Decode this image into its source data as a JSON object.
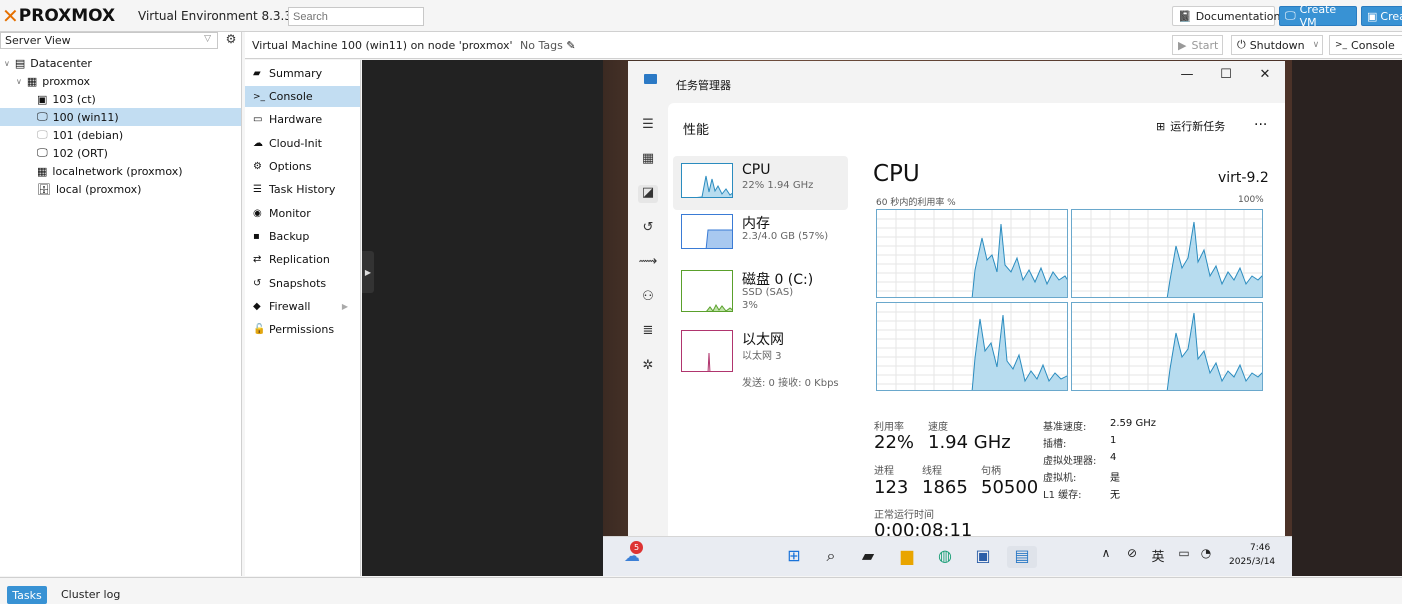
{
  "top": {
    "logo_text": "PROXMOX",
    "version": "Virtual Environment 8.3.3",
    "search_placeholder": "Search",
    "documentation": "Documentation",
    "create_vm": "Create VM",
    "create_ct": "Crea"
  },
  "tree": {
    "view": "Server View",
    "items": [
      {
        "label": "Datacenter",
        "icon": "datacenter-icon"
      },
      {
        "label": "proxmox",
        "icon": "node-icon"
      },
      {
        "label": "103 (ct)",
        "icon": "container-icon"
      },
      {
        "label": "100 (win11)",
        "icon": "vm-running-icon"
      },
      {
        "label": "101 (debian)",
        "icon": "vm-stopped-icon"
      },
      {
        "label": "102 (ORT)",
        "icon": "vm-running-icon"
      },
      {
        "label": "localnetwork (proxmox)",
        "icon": "network-icon"
      },
      {
        "label": "local (proxmox)",
        "icon": "storage-icon"
      }
    ]
  },
  "vm": {
    "title": "Virtual Machine 100 (win11) on node 'proxmox'",
    "tags": "No Tags",
    "start": "Start",
    "shutdown": "Shutdown",
    "console": "Console"
  },
  "nav": [
    {
      "label": "Summary",
      "icon": "book-icon"
    },
    {
      "label": "Console",
      "icon": "terminal-icon"
    },
    {
      "label": "Hardware",
      "icon": "desktop-icon"
    },
    {
      "label": "Cloud-Init",
      "icon": "cloud-icon"
    },
    {
      "label": "Options",
      "icon": "gear-icon"
    },
    {
      "label": "Task History",
      "icon": "list-icon"
    },
    {
      "label": "Monitor",
      "icon": "eye-icon"
    },
    {
      "label": "Backup",
      "icon": "floppy-icon"
    },
    {
      "label": "Replication",
      "icon": "retweet-icon"
    },
    {
      "label": "Snapshots",
      "icon": "history-icon"
    },
    {
      "label": "Firewall",
      "icon": "shield-icon"
    },
    {
      "label": "Permissions",
      "icon": "unlock-icon"
    }
  ],
  "taskmanager": {
    "title": "任务管理器",
    "section": "性能",
    "run_new_task": "运行新任务",
    "cards": [
      {
        "name": "CPU",
        "sub1": "22% 1.94 GHz",
        "sub2": ""
      },
      {
        "name": "内存",
        "sub1": "2.3/4.0 GB (57%)",
        "sub2": ""
      },
      {
        "name": "磁盘 0 (C:)",
        "sub1": "SSD (SAS)",
        "sub2": "3%"
      },
      {
        "name": "以太网",
        "sub1": "以太网 3",
        "sub2": "发送: 0 接收: 0 Kbps"
      }
    ],
    "cpu_heading": "CPU",
    "cpu_model": "virt-9.2",
    "util_caption": "60 秒内的利用率 %",
    "util_max": "100%",
    "stats": {
      "utilization_label": "利用率",
      "utilization": "22%",
      "speed_label": "速度",
      "speed": "1.94 GHz",
      "processes_label": "进程",
      "processes": "123",
      "threads_label": "线程",
      "threads": "1865",
      "handles_label": "句柄",
      "handles": "50500",
      "uptime_label": "正常运行时间",
      "uptime": "0:00:08:11"
    },
    "details": [
      {
        "k": "基准速度:",
        "v": "2.59 GHz"
      },
      {
        "k": "插槽:",
        "v": "1"
      },
      {
        "k": "虚拟处理器:",
        "v": "4"
      },
      {
        "k": "虚拟机:",
        "v": "是"
      },
      {
        "k": "L1 缓存:",
        "v": "无"
      }
    ]
  },
  "taskbar": {
    "weather_badge": "5",
    "ime": "英",
    "time": "7:46",
    "date": "2025/3/14"
  },
  "bottom": {
    "tasks": "Tasks",
    "cluster_log": "Cluster log"
  },
  "colors": {
    "accent": "#3892d4",
    "logo_orange": "#e57000",
    "selection": "#c2ddf2",
    "graph_fill": "#b7dcef",
    "graph_line": "#2b8cbf"
  }
}
